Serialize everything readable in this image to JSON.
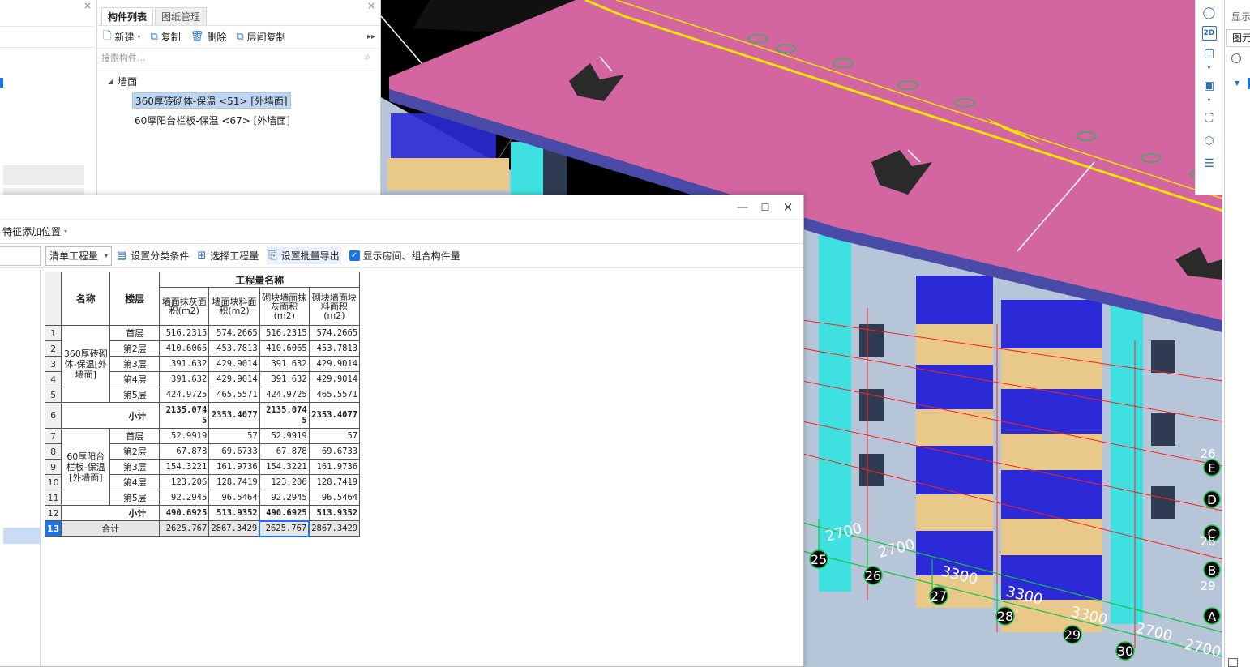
{
  "left_strip": {
    "close_glyph": "×"
  },
  "component_panel": {
    "tabs": [
      {
        "label": "构件列表"
      },
      {
        "label": "图纸管理"
      }
    ],
    "close_glyph": "×",
    "toolbar": {
      "new_label": "新建",
      "copy_label": "复制",
      "delete_label": "删除",
      "floor_copy_label": "层间复制",
      "more_glyph": "▸▸"
    },
    "search": {
      "placeholder": "搜索构件..."
    },
    "tree": {
      "group_label": "墙面",
      "items": [
        {
          "label": "360厚砖砌体-保温 <51> [外墙面]",
          "selected": true
        },
        {
          "label": "60厚阳台栏板-保温 <67> [外墙面]",
          "selected": false
        }
      ]
    }
  },
  "viewport": {
    "dimension_labels": [
      "2700",
      "2700",
      "3300",
      "3300",
      "3300",
      "2700",
      "2700"
    ],
    "axis_numbers": [
      "25",
      "26",
      "27",
      "28",
      "29",
      "30"
    ],
    "axis_letters": [
      "E",
      "D",
      "C",
      "B",
      "A"
    ],
    "side_numbers": [
      "26",
      "28",
      "29"
    ],
    "colors": {
      "roof": "#d366a0",
      "roof_outline": "#f2e400",
      "grid_red": "#ff2020",
      "grid_green": "#16c24a",
      "wall": "#b6c6d8",
      "window": "#2b2ad6",
      "insulation": "#e8c98a",
      "column": "#3ee0e0"
    }
  },
  "right_toolbar": {
    "view_2d_label": "2D"
  },
  "right_panel": {
    "title": "显示",
    "field": "图元"
  },
  "report": {
    "window_buttons": {
      "minimize": "—",
      "maximize": "☐",
      "close": "✕"
    },
    "feature_label": "特征添加位置",
    "toolbar": {
      "qty_select_value": "清单工程量",
      "set_class_label": "设置分类条件",
      "select_qty_label": "选择工程量",
      "batch_export_label": "设置批量导出",
      "show_rooms_label": "显示房间、组合构件量",
      "show_rooms_checked": true
    },
    "table": {
      "header_name": "名称",
      "header_floor": "楼层",
      "header_group": "工程量名称",
      "columns": [
        "墙面抹灰面积(m2)",
        "墙面块料面积(m2)",
        "砌块墙面抹灰面积(m2)",
        "砌块墙面块料面积(m2)"
      ],
      "groups": [
        {
          "name": "360厚砖砌体-保温[外墙面]",
          "rows": [
            {
              "no": "1",
              "floor": "首层",
              "values": [
                "516.2315",
                "574.2665",
                "516.2315",
                "574.2665"
              ]
            },
            {
              "no": "2",
              "floor": "第2层",
              "values": [
                "410.6065",
                "453.7813",
                "410.6065",
                "453.7813"
              ]
            },
            {
              "no": "3",
              "floor": "第3层",
              "values": [
                "391.632",
                "429.9014",
                "391.632",
                "429.9014"
              ]
            },
            {
              "no": "4",
              "floor": "第4层",
              "values": [
                "391.632",
                "429.9014",
                "391.632",
                "429.9014"
              ]
            },
            {
              "no": "5",
              "floor": "第5层",
              "values": [
                "424.9725",
                "465.5571",
                "424.9725",
                "465.5571"
              ]
            }
          ],
          "subtotal": {
            "no": "6",
            "label": "小计",
            "values": [
              "2135.0745",
              "2353.4077",
              "2135.0745",
              "2353.4077"
            ]
          }
        },
        {
          "name": "60厚阳台栏板-保温[外墙面]",
          "rows": [
            {
              "no": "7",
              "floor": "首层",
              "values": [
                "52.9919",
                "57",
                "52.9919",
                "57"
              ]
            },
            {
              "no": "8",
              "floor": "第2层",
              "values": [
                "67.878",
                "69.6733",
                "67.878",
                "69.6733"
              ]
            },
            {
              "no": "9",
              "floor": "第3层",
              "values": [
                "154.3221",
                "161.9736",
                "154.3221",
                "161.9736"
              ]
            },
            {
              "no": "10",
              "floor": "第4层",
              "values": [
                "123.206",
                "128.7419",
                "123.206",
                "128.7419"
              ]
            },
            {
              "no": "11",
              "floor": "第5层",
              "values": [
                "92.2945",
                "96.5464",
                "92.2945",
                "96.5464"
              ]
            }
          ],
          "subtotal": {
            "no": "12",
            "label": "小计",
            "values": [
              "490.6925",
              "513.9352",
              "490.6925",
              "513.9352"
            ]
          }
        }
      ],
      "total": {
        "no": "13",
        "label": "合计",
        "values": [
          "2625.767",
          "2867.3429",
          "2625.767",
          "2867.3429"
        ]
      }
    }
  }
}
